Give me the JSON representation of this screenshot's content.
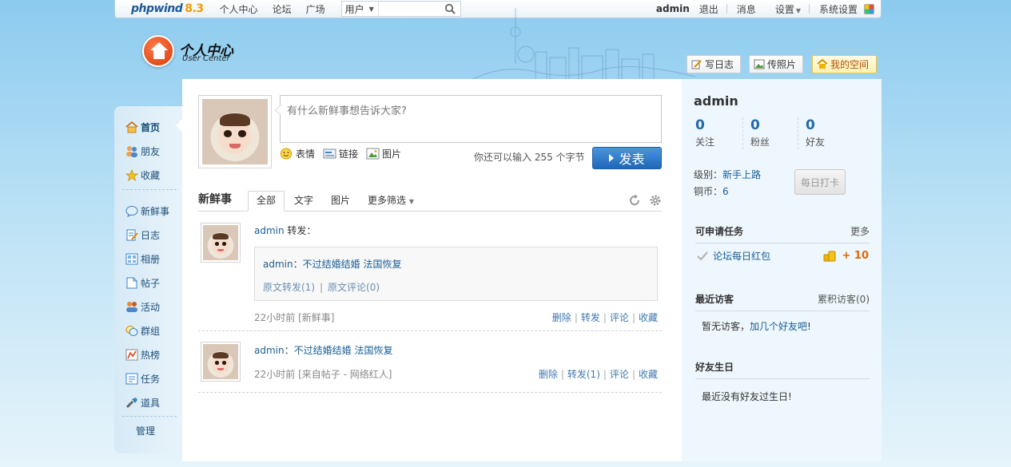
{
  "topbar": {
    "logo_text": "phpwind",
    "logo_version": "8.3",
    "nav": [
      "个人中心",
      "论坛",
      "广场"
    ],
    "search_select": "用户",
    "search_value": "",
    "user": "admin",
    "logout": "退出",
    "messages": "消息",
    "settings": "设置",
    "system_settings": "系统设置"
  },
  "header": {
    "title": "个人中心",
    "subtitle": "User Center",
    "buttons": {
      "write_blog": "写日志",
      "upload_photo": "传照片",
      "my_space": "我的空间"
    }
  },
  "sidebar": {
    "items": [
      {
        "label": "首页",
        "icon": "home-icon"
      },
      {
        "label": "朋友",
        "icon": "friends-icon"
      },
      {
        "label": "收藏",
        "icon": "star-icon"
      },
      {
        "label": "新鲜事",
        "icon": "chat-bubble-icon"
      },
      {
        "label": "日志",
        "icon": "blog-icon"
      },
      {
        "label": "相册",
        "icon": "album-icon"
      },
      {
        "label": "帖子",
        "icon": "post-icon"
      },
      {
        "label": "活动",
        "icon": "activity-icon"
      },
      {
        "label": "群组",
        "icon": "group-icon"
      },
      {
        "label": "热榜",
        "icon": "hot-list-icon"
      },
      {
        "label": "任务",
        "icon": "task-icon"
      },
      {
        "label": "道具",
        "icon": "tool-icon"
      }
    ],
    "admin": "管理"
  },
  "composer": {
    "placeholder": "有什么新鲜事想告诉大家?",
    "tools": [
      "表情",
      "链接",
      "图片"
    ],
    "char_hint": "你还可以输入 255 个字节",
    "publish": "发表"
  },
  "feed": {
    "title": "新鲜事",
    "tabs": [
      {
        "label": "全部"
      },
      {
        "label": "文字"
      },
      {
        "label": "图片"
      },
      {
        "label": "更多筛选"
      }
    ],
    "items": [
      {
        "user": "admin",
        "action": " 转发：",
        "quote_user": "admin",
        "quote_sep": "：",
        "quote_text": "不过结婚结婚  法国恢复",
        "quote_forward": "原文转发(1)",
        "quote_comment": "原文评论(0)",
        "time": "22小时前",
        "source": "[新鲜事]",
        "actions": [
          "删除",
          "转发",
          "评论",
          "收藏"
        ]
      },
      {
        "user": "admin",
        "sep": "：",
        "text": "不过结婚结婚  法国恢复",
        "time": "22小时前",
        "source": "[来自帖子 - 网络红人]",
        "actions": [
          "删除",
          "转发(1)",
          "评论",
          "收藏"
        ]
      }
    ]
  },
  "profile": {
    "name": "admin",
    "stats": [
      {
        "value": "0",
        "label": "关注"
      },
      {
        "value": "0",
        "label": "粉丝"
      },
      {
        "value": "0",
        "label": "好友"
      }
    ],
    "level_label": "级别：",
    "level_value": "新手上路",
    "coin_label": "铜币：",
    "coin_value": "6",
    "checkin": "每日打卡"
  },
  "tasks": {
    "title": "可申请任务",
    "more": "更多",
    "item": "论坛每日红包",
    "reward": "+ 10"
  },
  "visitors": {
    "title": "最近访客",
    "total": "累积访客(0)",
    "empty_prefix": "暂无访客，",
    "empty_link": "加几个好友吧",
    "empty_suffix": "!"
  },
  "birthdays": {
    "title": "好友生日",
    "empty": "最近没有好友过生日!"
  }
}
